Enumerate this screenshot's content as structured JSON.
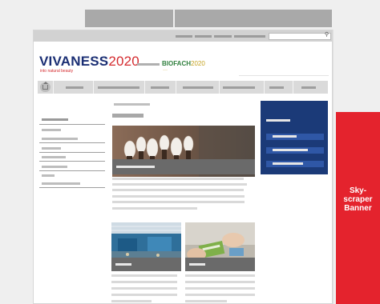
{
  "brand": {
    "vivaness": {
      "name": "VIVANESS",
      "year": "2020",
      "tagline": "into natural beauty"
    },
    "biofach": {
      "name": "BIOFACH",
      "year": "2020"
    }
  },
  "search": {
    "icon": "search-icon",
    "placeholder": ""
  },
  "nav": {
    "home_icon": "home-icon",
    "item_count": 7
  },
  "skyscraper": {
    "label": "Sky-\nscraper\nBanner",
    "color": "#e4232d"
  },
  "colors": {
    "brand_blue": "#1b2f74",
    "brand_red": "#d42a2e",
    "biofach_green": "#2f7f3d",
    "biofach_gold": "#c5a220",
    "info_box_blue": "#1b3a78",
    "banner_red": "#e4232d"
  }
}
